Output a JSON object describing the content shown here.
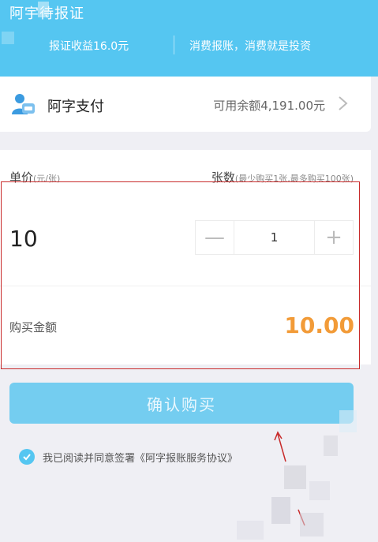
{
  "header": {
    "title": "阿宇待报证",
    "earnings": "报证收益16.0元",
    "slogan": "消费报账，消费就是投资"
  },
  "payment": {
    "name": "阿字支付",
    "balance": "可用余额4,191.00元"
  },
  "purchase": {
    "price_label": "单价",
    "price_unit": "(元/张)",
    "qty_label": "张数",
    "qty_hint": "(最少购买1张,最多购买100张)",
    "price_value": "10",
    "quantity": "1",
    "minus": "—",
    "plus": "+",
    "amount_label": "购买金额",
    "amount_value": "10.00"
  },
  "actions": {
    "confirm": "确认购买",
    "agreement": "我已阅读并同意签署《阿字报账服务协议》"
  },
  "colors": {
    "primary": "#55c6f1",
    "button": "#74cdf0",
    "amount": "#f29b38",
    "highlight": "#c82a2a"
  }
}
